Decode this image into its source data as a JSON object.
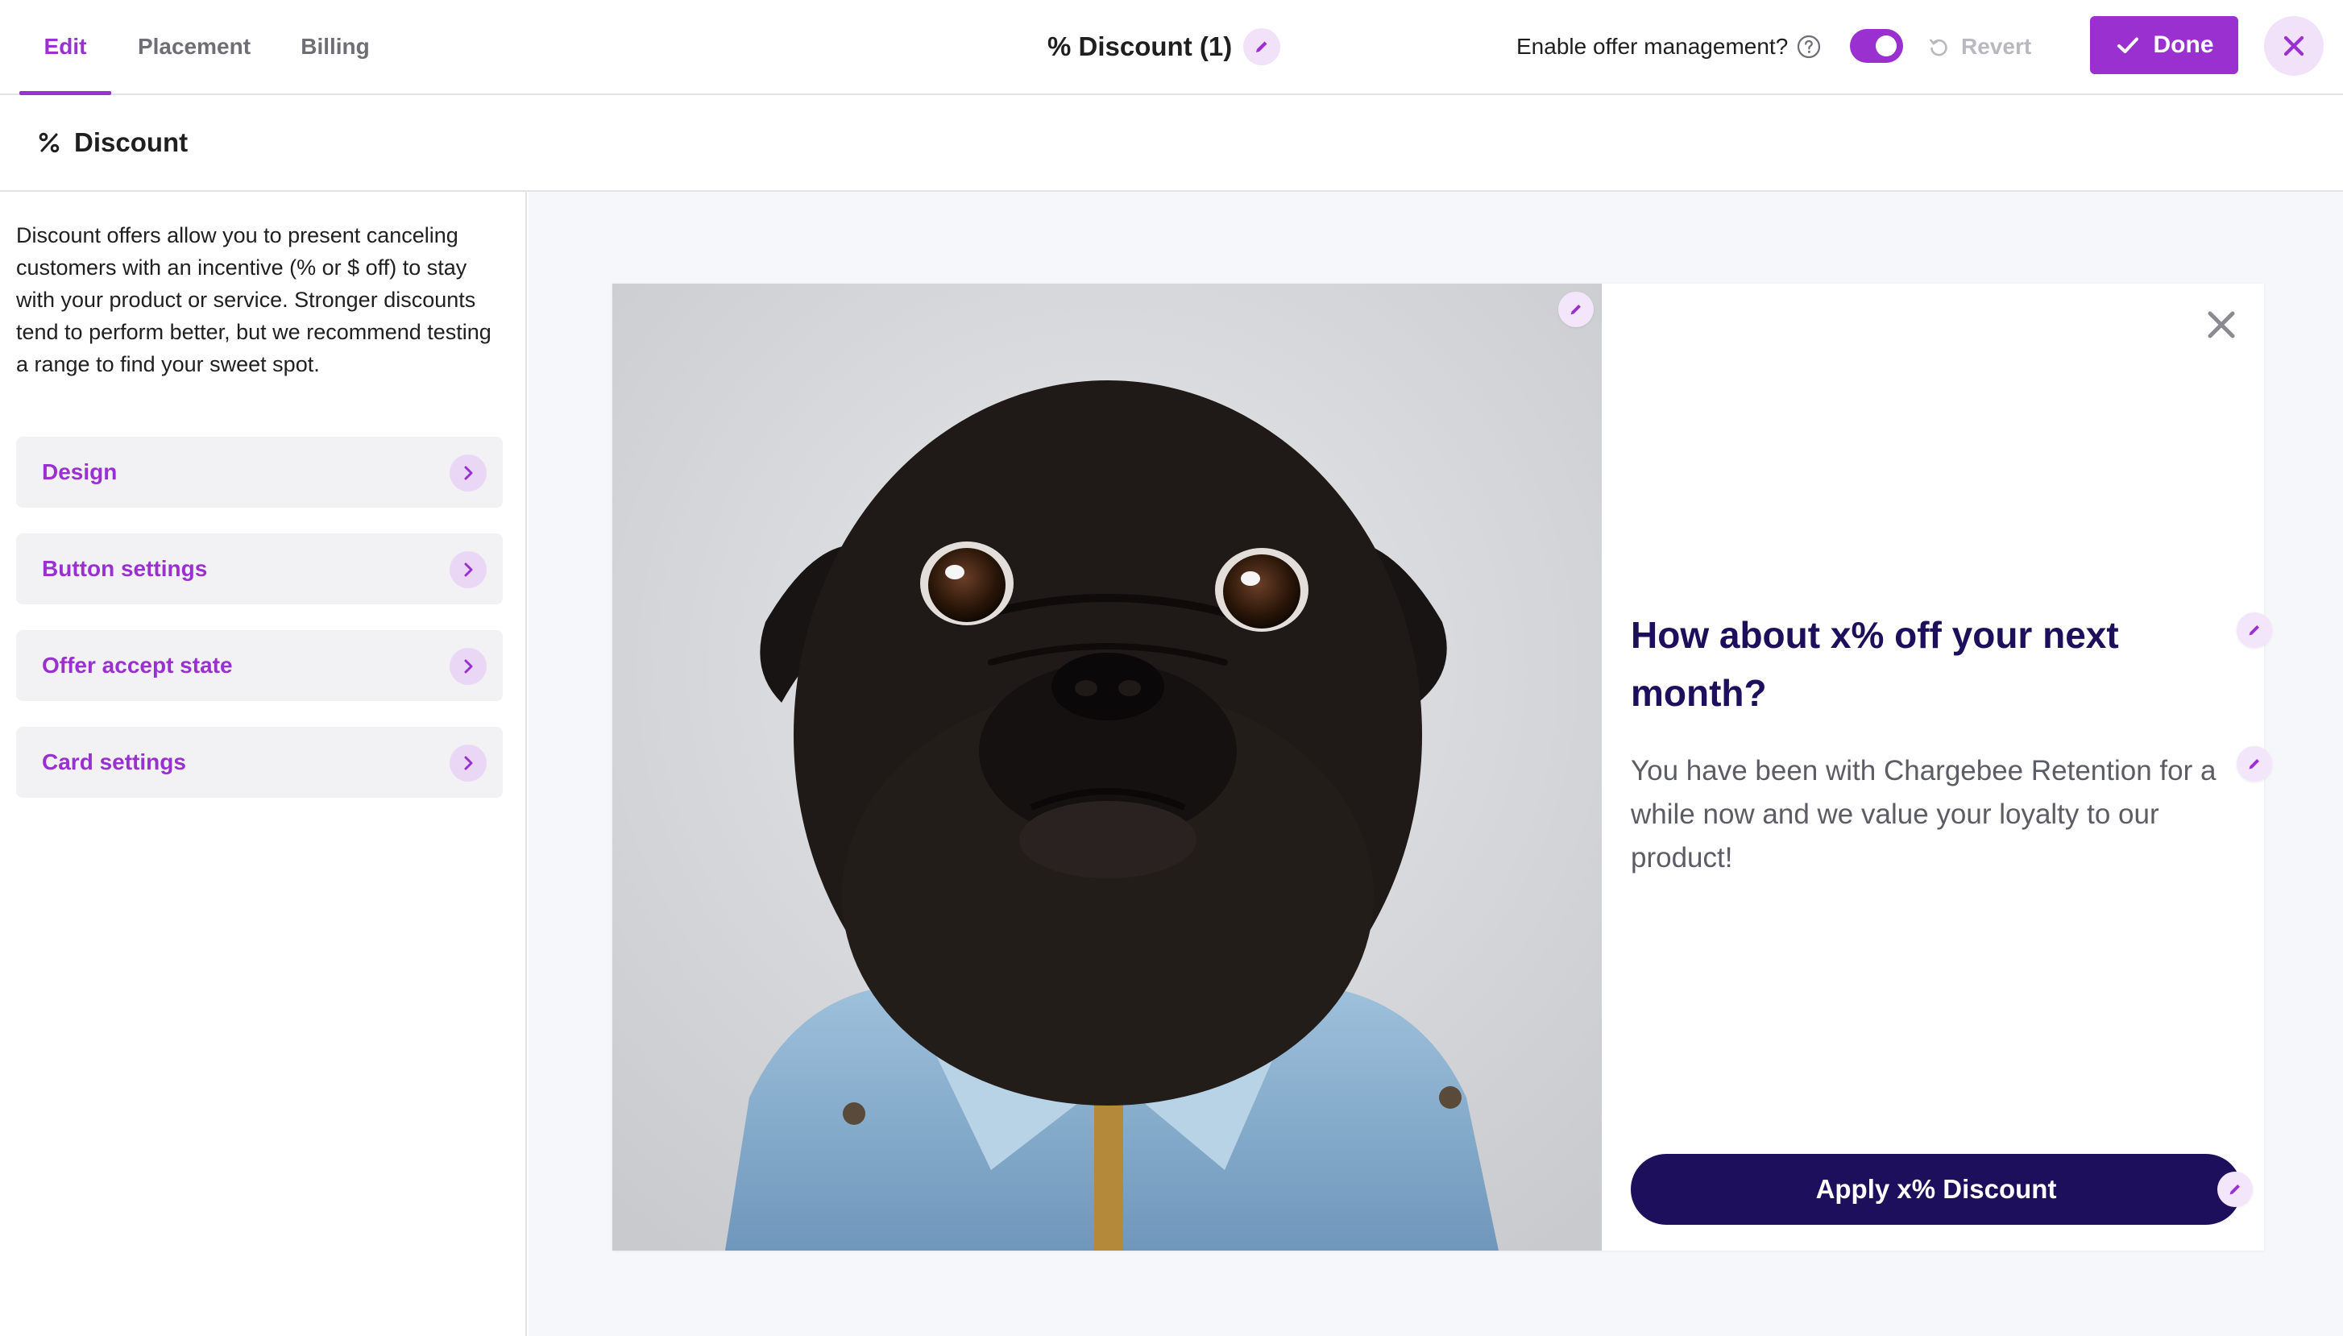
{
  "tabs": [
    {
      "label": "Edit",
      "active": true
    },
    {
      "label": "Placement",
      "active": false
    },
    {
      "label": "Billing",
      "active": false
    }
  ],
  "header": {
    "title": "% Discount (1)",
    "offer_management_label": "Enable offer management?",
    "offer_management_enabled": true,
    "revert_label": "Revert",
    "done_label": "Done"
  },
  "subheader": {
    "icon": "percent-icon",
    "title": "Discount"
  },
  "sidebar": {
    "description": "Discount offers allow you to present canceling customers with an incentive (% or $ off) to stay with your product or service. Stronger discounts tend to perform better, but we recommend testing a range to find your sweet spot.",
    "items": [
      {
        "label": "Design"
      },
      {
        "label": "Button settings"
      },
      {
        "label": "Offer accept state"
      },
      {
        "label": "Card settings"
      }
    ]
  },
  "offer": {
    "headline": "How about x% off your next month?",
    "body": "You have been with Chargebee Retention for a while now and we value your loyalty to our product!",
    "button_label": "Apply x% Discount"
  },
  "colors": {
    "accent": "#9b30d0",
    "navy": "#1e0f5c",
    "preview_bg": "#f6f7fb"
  }
}
